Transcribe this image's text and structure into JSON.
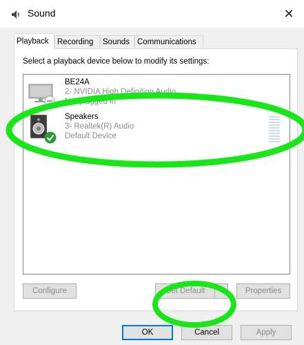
{
  "window": {
    "title": "Sound",
    "close_glyph": "✕"
  },
  "tabs": [
    {
      "label": "Playback",
      "active": true
    },
    {
      "label": "Recording",
      "active": false
    },
    {
      "label": "Sounds",
      "active": false
    },
    {
      "label": "Communications",
      "active": false
    }
  ],
  "instruction": "Select a playback device below to modify its settings:",
  "devices": [
    {
      "name": "BE24A",
      "line2": "2- NVIDIA High Definition Audio",
      "line3": "Not plugged in",
      "icon": "monitor-speaker-icon",
      "status_icon": "unplugged-icon"
    },
    {
      "name": "Speakers",
      "line2": "3- Realtek(R) Audio",
      "line3": "Default Device",
      "icon": "speaker-icon",
      "status_icon": "default-check-icon",
      "default": true
    }
  ],
  "buttons": {
    "configure": {
      "label": "Configure",
      "enabled": false
    },
    "set_default": {
      "label": "Set Default",
      "enabled": false
    },
    "properties": {
      "label": "Properties",
      "enabled": false
    },
    "ok": {
      "label": "OK",
      "enabled": true
    },
    "cancel": {
      "label": "Cancel",
      "enabled": true
    },
    "apply": {
      "label": "Apply",
      "enabled": false
    }
  },
  "colors": {
    "annotation_green": "#19e619",
    "check_green": "#2a9d3a",
    "focus_blue": "#0078d7"
  }
}
